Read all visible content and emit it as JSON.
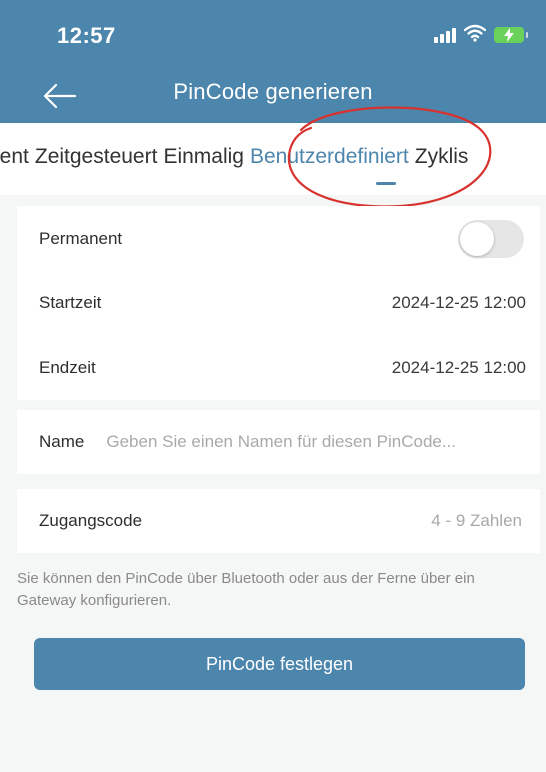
{
  "status_bar": {
    "time": "12:57",
    "icons": [
      "signal-icon",
      "wifi-icon",
      "battery-charging-icon"
    ]
  },
  "header": {
    "title": "PinCode generieren",
    "back_icon": "arrow-left-icon",
    "color": "#4d86ad"
  },
  "tabs": [
    {
      "label": "nent",
      "active": false
    },
    {
      "label": "Zeitgesteuert",
      "active": false
    },
    {
      "label": "Einmalig",
      "active": false
    },
    {
      "label": "Benutzerdefiniert",
      "active": true
    },
    {
      "label": "Zyklis",
      "active": false
    }
  ],
  "form": {
    "permanent_label": "Permanent",
    "permanent_toggle_on": false,
    "start_label": "Startzeit",
    "start_value": "2024-12-25 12:00",
    "end_label": "Endzeit",
    "end_value": "2024-12-25 12:00",
    "name_label": "Name",
    "name_placeholder": "Geben Sie einen Namen für diesen PinCode...",
    "code_label": "Zugangscode",
    "code_placeholder": "4 - 9 Zahlen"
  },
  "hint_text": "Sie können den PinCode über Bluetooth oder aus der Ferne über ein Gateway konfigurieren.",
  "submit_label": "PinCode festlegen",
  "colors": {
    "accent": "#4d86ad",
    "annotation": "#d8322e",
    "background": "#f5f6f6"
  }
}
